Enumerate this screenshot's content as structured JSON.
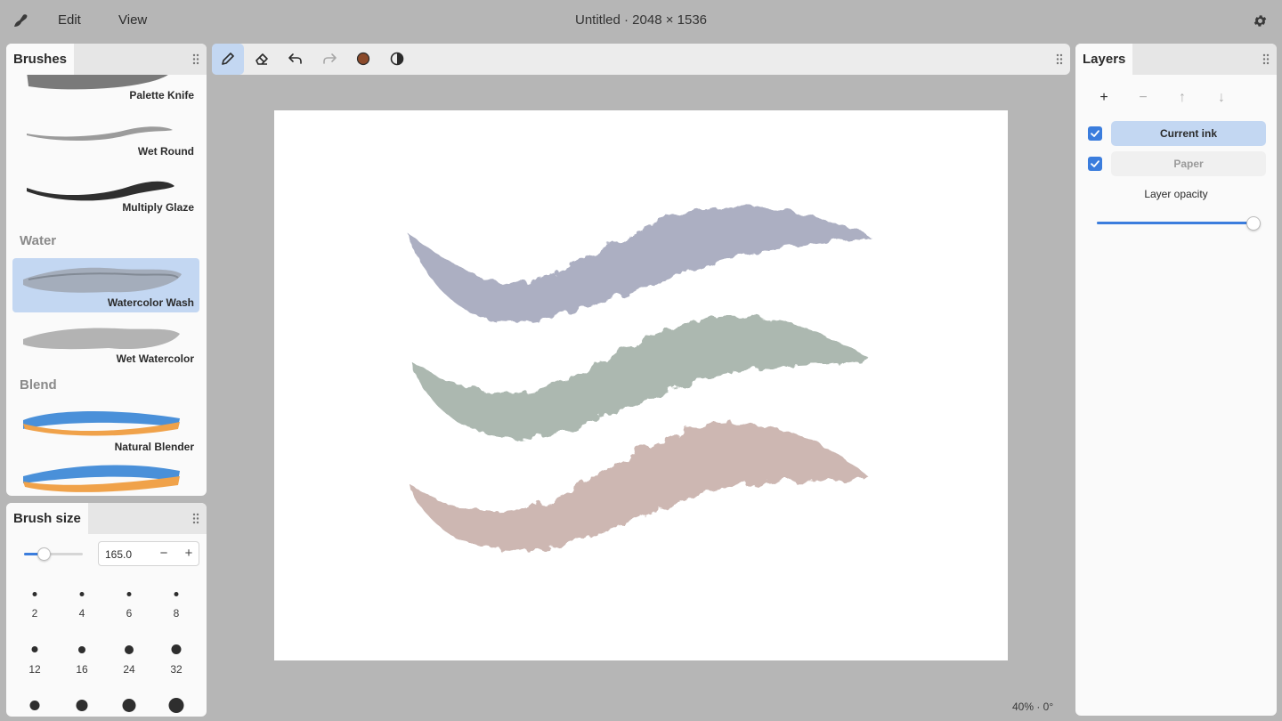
{
  "app": {
    "icon": "brush-app-icon",
    "menu": [
      "Edit",
      "View"
    ],
    "title": "Untitled · 2048 × 1536",
    "settings_icon": "gear-icon"
  },
  "brushes_panel": {
    "title": "Brushes",
    "items": [
      {
        "label": "Palette Knife",
        "icon": "palette-knife-stroke",
        "selected": false
      },
      {
        "label": "Wet Round",
        "icon": "wet-round-stroke",
        "selected": false
      },
      {
        "label": "Multiply Glaze",
        "icon": "multiply-glaze-stroke",
        "selected": false
      },
      {
        "label": "Watercolor Wash",
        "icon": "watercolor-wash-stroke",
        "selected": true
      },
      {
        "label": "Wet Watercolor",
        "icon": "wet-watercolor-stroke",
        "selected": false
      },
      {
        "label": "Natural Blender",
        "icon": "natural-blender-stroke",
        "selected": false
      },
      {
        "label": "",
        "icon": "blender-stroke",
        "selected": false
      }
    ],
    "groups": [
      "Water",
      "Blend"
    ]
  },
  "brush_size": {
    "title": "Brush size",
    "value": "165.0",
    "slider_fraction": 0.3,
    "minus": "−",
    "plus": "+",
    "presets": [
      "2",
      "4",
      "6",
      "8",
      "12",
      "16",
      "24",
      "32"
    ]
  },
  "toolbar": {
    "tools": [
      {
        "icon": "pencil-icon",
        "active": true
      },
      {
        "icon": "eraser-icon",
        "active": false
      },
      {
        "icon": "undo-icon",
        "active": false
      },
      {
        "icon": "redo-icon",
        "active": false
      },
      {
        "icon": "color-swatch-icon",
        "active": false
      },
      {
        "icon": "contrast-icon",
        "active": false
      }
    ],
    "color": "#8b4a2b"
  },
  "canvas": {
    "status": "40% · 0°",
    "stroke_colors": [
      "#a6a9bd",
      "#a5b3aa",
      "#c9b1ac"
    ]
  },
  "layers_panel": {
    "title": "Layers",
    "actions": [
      "+",
      "−",
      "↑",
      "↓"
    ],
    "layers": [
      {
        "name": "Current ink",
        "visible": true,
        "current": true
      },
      {
        "name": "Paper",
        "visible": true,
        "current": false
      }
    ],
    "opacity_label": "Layer opacity",
    "opacity_fraction": 1.0
  },
  "accent_color": "#3b7ddd"
}
